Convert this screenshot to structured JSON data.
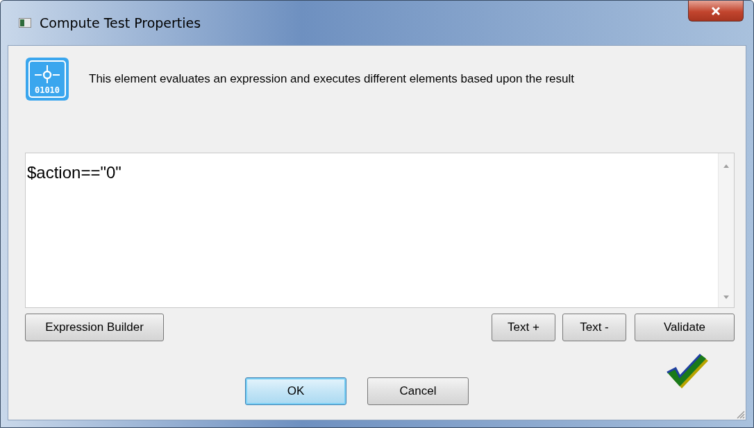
{
  "window": {
    "title": "Compute Test Properties"
  },
  "description": "This element evaluates an expression and executes different elements based upon the result",
  "expression": {
    "value": "$action==\"0\""
  },
  "element_icon_text": "01010",
  "left_buttons": [
    "Expression Builder"
  ],
  "right_buttons": [
    "Text +",
    "Text -",
    "Validate"
  ],
  "validation": {
    "valid": true
  },
  "dialog_buttons": [
    {
      "label": "OK",
      "default": true
    },
    {
      "label": "Cancel",
      "default": false
    }
  ]
}
